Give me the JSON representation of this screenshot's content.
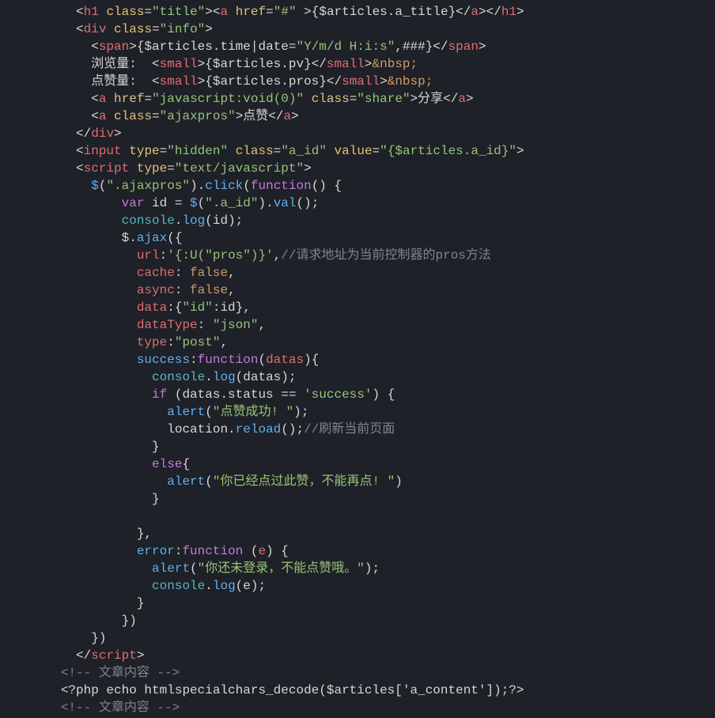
{
  "code": {
    "tokens": [
      [
        [
          "w",
          "          <"
        ],
        [
          "r",
          "h1"
        ],
        [
          "w",
          " "
        ],
        [
          "y",
          "class"
        ],
        [
          "w",
          "="
        ],
        [
          "g",
          "\"title\""
        ],
        [
          "w",
          ">"
        ],
        [
          "w",
          "<"
        ],
        [
          "r",
          "a"
        ],
        [
          "w",
          " "
        ],
        [
          "y",
          "href"
        ],
        [
          "w",
          "="
        ],
        [
          "g",
          "\"#\""
        ],
        [
          "w",
          " >{$articles.a_title}<"
        ],
        [
          "w",
          "/"
        ],
        [
          "r",
          "a"
        ],
        [
          "w",
          "><"
        ],
        [
          "w",
          "/"
        ],
        [
          "r",
          "h1"
        ],
        [
          "w",
          ">"
        ]
      ],
      [
        [
          "w",
          "          <"
        ],
        [
          "r",
          "div"
        ],
        [
          "w",
          " "
        ],
        [
          "y",
          "class"
        ],
        [
          "w",
          "="
        ],
        [
          "g",
          "\"info\""
        ],
        [
          "w",
          ">"
        ]
      ],
      [
        [
          "w",
          "            <"
        ],
        [
          "r",
          "span"
        ],
        [
          "w",
          ">{$articles.time|date="
        ],
        [
          "g",
          "\"Y/m/d H:i:s\""
        ],
        [
          "w",
          ",###}<"
        ],
        [
          "w",
          "/"
        ],
        [
          "r",
          "span"
        ],
        [
          "w",
          ">"
        ]
      ],
      [
        [
          "w",
          "            浏览量:  <"
        ],
        [
          "r",
          "small"
        ],
        [
          "w",
          ">{$articles.pv}<"
        ],
        [
          "w",
          "/"
        ],
        [
          "r",
          "small"
        ],
        [
          "w",
          ">"
        ],
        [
          "or",
          "&nbsp;"
        ]
      ],
      [
        [
          "w",
          "            点赞量:  <"
        ],
        [
          "r",
          "small"
        ],
        [
          "w",
          ">{$articles.pros}<"
        ],
        [
          "w",
          "/"
        ],
        [
          "r",
          "small"
        ],
        [
          "w",
          ">"
        ],
        [
          "or",
          "&nbsp;"
        ]
      ],
      [
        [
          "w",
          "            <"
        ],
        [
          "r",
          "a"
        ],
        [
          "w",
          " "
        ],
        [
          "y",
          "href"
        ],
        [
          "w",
          "="
        ],
        [
          "g",
          "\"javascript:void(0)\""
        ],
        [
          "w",
          " "
        ],
        [
          "y",
          "class"
        ],
        [
          "w",
          "="
        ],
        [
          "g",
          "\"share\""
        ],
        [
          "w",
          ">分享<"
        ],
        [
          "w",
          "/"
        ],
        [
          "r",
          "a"
        ],
        [
          "w",
          ">"
        ]
      ],
      [
        [
          "w",
          "            <"
        ],
        [
          "r",
          "a"
        ],
        [
          "w",
          " "
        ],
        [
          "y",
          "class"
        ],
        [
          "w",
          "="
        ],
        [
          "g",
          "\"ajaxpros\""
        ],
        [
          "w",
          ">点赞<"
        ],
        [
          "w",
          "/"
        ],
        [
          "r",
          "a"
        ],
        [
          "w",
          ">"
        ]
      ],
      [
        [
          "w",
          "          <"
        ],
        [
          "w",
          "/"
        ],
        [
          "r",
          "div"
        ],
        [
          "w",
          ">"
        ]
      ],
      [
        [
          "w",
          "          <"
        ],
        [
          "r",
          "input"
        ],
        [
          "w",
          " "
        ],
        [
          "y",
          "type"
        ],
        [
          "w",
          "="
        ],
        [
          "g",
          "\"hidden\""
        ],
        [
          "w",
          " "
        ],
        [
          "y",
          "class"
        ],
        [
          "w",
          "="
        ],
        [
          "g",
          "\"a_id\""
        ],
        [
          "w",
          " "
        ],
        [
          "y",
          "value"
        ],
        [
          "w",
          "="
        ],
        [
          "g",
          "\"{$articles.a_id}\""
        ],
        [
          "w",
          ">"
        ]
      ],
      [
        [
          "w",
          "          <"
        ],
        [
          "r",
          "script"
        ],
        [
          "w",
          " "
        ],
        [
          "y",
          "type"
        ],
        [
          "w",
          "="
        ],
        [
          "g",
          "\"text/javascript\""
        ],
        [
          "w",
          ">"
        ]
      ],
      [
        [
          "w",
          "            "
        ],
        [
          "bl",
          "$"
        ],
        [
          "w",
          "("
        ],
        [
          "g",
          "\".ajaxpros\""
        ],
        [
          "w",
          ")."
        ],
        [
          "bl",
          "click"
        ],
        [
          "w",
          "("
        ],
        [
          "p",
          "function"
        ],
        [
          "w",
          "() {"
        ]
      ],
      [
        [
          "w",
          "                "
        ],
        [
          "p",
          "var"
        ],
        [
          "w",
          " id = "
        ],
        [
          "bl",
          "$"
        ],
        [
          "w",
          "("
        ],
        [
          "g",
          "\".a_id\""
        ],
        [
          "w",
          ")."
        ],
        [
          "bl",
          "val"
        ],
        [
          "w",
          "();"
        ]
      ],
      [
        [
          "w",
          "                "
        ],
        [
          "cy",
          "console"
        ],
        [
          "w",
          "."
        ],
        [
          "bl",
          "log"
        ],
        [
          "w",
          "(id);"
        ]
      ],
      [
        [
          "w",
          "                $."
        ],
        [
          "bl",
          "ajax"
        ],
        [
          "w",
          "({"
        ]
      ],
      [
        [
          "w",
          "                  "
        ],
        [
          "r",
          "url"
        ],
        [
          "w",
          ":"
        ],
        [
          "g",
          "'{:U(\"pros\")}'"
        ],
        [
          "w",
          ","
        ],
        [
          "gr",
          "//请求地址为当前控制器的pros方法"
        ]
      ],
      [
        [
          "w",
          "                  "
        ],
        [
          "r",
          "cache"
        ],
        [
          "w",
          ": "
        ],
        [
          "or",
          "false"
        ],
        [
          "w",
          ","
        ]
      ],
      [
        [
          "w",
          "                  "
        ],
        [
          "r",
          "async"
        ],
        [
          "w",
          ": "
        ],
        [
          "or",
          "false"
        ],
        [
          "w",
          ","
        ]
      ],
      [
        [
          "w",
          "                  "
        ],
        [
          "r",
          "data"
        ],
        [
          "w",
          ":{"
        ],
        [
          "g",
          "\"id\""
        ],
        [
          "w",
          ":id},"
        ]
      ],
      [
        [
          "w",
          "                  "
        ],
        [
          "r",
          "dataType"
        ],
        [
          "w",
          ": "
        ],
        [
          "g",
          "\"json\""
        ],
        [
          "w",
          ","
        ]
      ],
      [
        [
          "w",
          "                  "
        ],
        [
          "r",
          "type"
        ],
        [
          "w",
          ":"
        ],
        [
          "g",
          "\"post\""
        ],
        [
          "w",
          ","
        ]
      ],
      [
        [
          "w",
          "                  "
        ],
        [
          "bl",
          "success"
        ],
        [
          "w",
          ":"
        ],
        [
          "p",
          "function"
        ],
        [
          "w",
          "("
        ],
        [
          "r",
          "datas"
        ],
        [
          "w",
          "){"
        ]
      ],
      [
        [
          "w",
          "                    "
        ],
        [
          "cy",
          "console"
        ],
        [
          "w",
          "."
        ],
        [
          "bl",
          "log"
        ],
        [
          "w",
          "(datas);"
        ]
      ],
      [
        [
          "w",
          "                    "
        ],
        [
          "p",
          "if"
        ],
        [
          "w",
          " (datas.status == "
        ],
        [
          "g",
          "'success'"
        ],
        [
          "w",
          ") {"
        ]
      ],
      [
        [
          "w",
          "                      "
        ],
        [
          "bl",
          "alert"
        ],
        [
          "w",
          "("
        ],
        [
          "g",
          "\"点赞成功! \""
        ],
        [
          "w",
          ");"
        ]
      ],
      [
        [
          "w",
          "                      location."
        ],
        [
          "bl",
          "reload"
        ],
        [
          "w",
          "();"
        ],
        [
          "gr",
          "//刷新当前页面"
        ]
      ],
      [
        [
          "w",
          "                    }"
        ]
      ],
      [
        [
          "w",
          "                    "
        ],
        [
          "p",
          "else"
        ],
        [
          "w",
          "{"
        ]
      ],
      [
        [
          "w",
          "                      "
        ],
        [
          "bl",
          "alert"
        ],
        [
          "w",
          "("
        ],
        [
          "g",
          "\"你已经点过此赞，不能再点! \""
        ],
        [
          "w",
          ")"
        ]
      ],
      [
        [
          "w",
          "                    }"
        ]
      ],
      [
        [
          "w",
          ""
        ]
      ],
      [
        [
          "w",
          "                  },"
        ]
      ],
      [
        [
          "w",
          "                  "
        ],
        [
          "bl",
          "error"
        ],
        [
          "w",
          ":"
        ],
        [
          "p",
          "function"
        ],
        [
          "w",
          " ("
        ],
        [
          "r",
          "e"
        ],
        [
          "w",
          ") {"
        ]
      ],
      [
        [
          "w",
          "                    "
        ],
        [
          "bl",
          "alert"
        ],
        [
          "w",
          "("
        ],
        [
          "g",
          "\"你还未登录，不能点赞哦。\""
        ],
        [
          "w",
          ");"
        ]
      ],
      [
        [
          "w",
          "                    "
        ],
        [
          "cy",
          "console"
        ],
        [
          "w",
          "."
        ],
        [
          "bl",
          "log"
        ],
        [
          "w",
          "(e);"
        ]
      ],
      [
        [
          "w",
          "                  }"
        ]
      ],
      [
        [
          "w",
          "                })"
        ]
      ],
      [
        [
          "w",
          "            })"
        ]
      ],
      [
        [
          "w",
          "          <"
        ],
        [
          "w",
          "/"
        ],
        [
          "r",
          "script"
        ],
        [
          "w",
          ">"
        ]
      ],
      [
        [
          "w",
          "        "
        ],
        [
          "gr",
          "<!-- 文章内容 -->"
        ]
      ],
      [
        [
          "w",
          "        <?php echo htmlspecialchars_decode($articles['a_content']);?>"
        ]
      ],
      [
        [
          "w",
          "        "
        ],
        [
          "gr",
          "<!-- 文章内容 -->"
        ]
      ]
    ]
  }
}
